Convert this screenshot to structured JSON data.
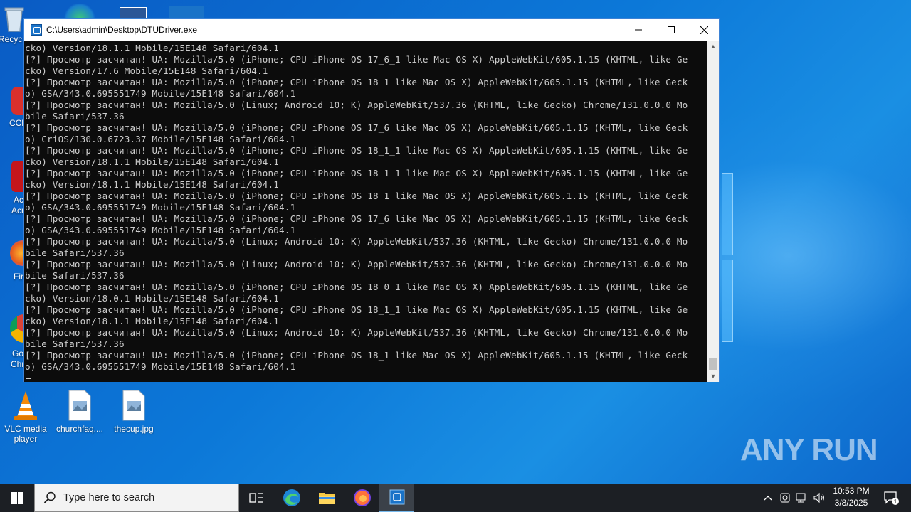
{
  "desktop": {
    "icons": [
      {
        "label": "Recycle Bin",
        "visible_label": "Recyc"
      },
      {
        "label": "VLC media player"
      },
      {
        "label": "churchfaq...."
      },
      {
        "label": "thecup.jpg"
      }
    ],
    "edge_labels": [
      "CCl",
      "Ac",
      "Acr",
      "Fir",
      "Go",
      "Chr"
    ],
    "watermark": "ANY RUN"
  },
  "console": {
    "title": "C:\\Users\\admin\\Desktop\\DTUDriver.exe",
    "minimize_icon": "minimize-icon",
    "maximize_icon": "maximize-icon",
    "close_icon": "close-icon",
    "lines": [
      "cko) Version/18.1.1 Mobile/15E148 Safari/604.1",
      "[?] Просмотр засчитан! UA: Mozilla/5.0 (iPhone; CPU iPhone OS 17_6_1 like Mac OS X) AppleWebKit/605.1.15 (KHTML, like Ge",
      "cko) Version/17.6 Mobile/15E148 Safari/604.1",
      "[?] Просмотр засчитан! UA: Mozilla/5.0 (iPhone; CPU iPhone OS 18_1 like Mac OS X) AppleWebKit/605.1.15 (KHTML, like Geck",
      "o) GSA/343.0.695551749 Mobile/15E148 Safari/604.1",
      "[?] Просмотр засчитан! UA: Mozilla/5.0 (Linux; Android 10; K) AppleWebKit/537.36 (KHTML, like Gecko) Chrome/131.0.0.0 Mo",
      "bile Safari/537.36",
      "[?] Просмотр засчитан! UA: Mozilla/5.0 (iPhone; CPU iPhone OS 17_6 like Mac OS X) AppleWebKit/605.1.15 (KHTML, like Geck",
      "o) CriOS/130.0.6723.37 Mobile/15E148 Safari/604.1",
      "[?] Просмотр засчитан! UA: Mozilla/5.0 (iPhone; CPU iPhone OS 18_1_1 like Mac OS X) AppleWebKit/605.1.15 (KHTML, like Ge",
      "cko) Version/18.1.1 Mobile/15E148 Safari/604.1",
      "[?] Просмотр засчитан! UA: Mozilla/5.0 (iPhone; CPU iPhone OS 18_1_1 like Mac OS X) AppleWebKit/605.1.15 (KHTML, like Ge",
      "cko) Version/18.1.1 Mobile/15E148 Safari/604.1",
      "[?] Просмотр засчитан! UA: Mozilla/5.0 (iPhone; CPU iPhone OS 18_1 like Mac OS X) AppleWebKit/605.1.15 (KHTML, like Geck",
      "o) GSA/343.0.695551749 Mobile/15E148 Safari/604.1",
      "[?] Просмотр засчитан! UA: Mozilla/5.0 (iPhone; CPU iPhone OS 17_6 like Mac OS X) AppleWebKit/605.1.15 (KHTML, like Geck",
      "o) GSA/343.0.695551749 Mobile/15E148 Safari/604.1",
      "[?] Просмотр засчитан! UA: Mozilla/5.0 (Linux; Android 10; K) AppleWebKit/537.36 (KHTML, like Gecko) Chrome/131.0.0.0 Mo",
      "bile Safari/537.36",
      "[?] Просмотр засчитан! UA: Mozilla/5.0 (Linux; Android 10; K) AppleWebKit/537.36 (KHTML, like Gecko) Chrome/131.0.0.0 Mo",
      "bile Safari/537.36",
      "[?] Просмотр засчитан! UA: Mozilla/5.0 (iPhone; CPU iPhone OS 18_0_1 like Mac OS X) AppleWebKit/605.1.15 (KHTML, like Ge",
      "cko) Version/18.0.1 Mobile/15E148 Safari/604.1",
      "[?] Просмотр засчитан! UA: Mozilla/5.0 (iPhone; CPU iPhone OS 18_1_1 like Mac OS X) AppleWebKit/605.1.15 (KHTML, like Ge",
      "cko) Version/18.1.1 Mobile/15E148 Safari/604.1",
      "[?] Просмотр засчитан! UA: Mozilla/5.0 (Linux; Android 10; K) AppleWebKit/537.36 (KHTML, like Gecko) Chrome/131.0.0.0 Mo",
      "bile Safari/537.36",
      "[?] Просмотр засчитан! UA: Mozilla/5.0 (iPhone; CPU iPhone OS 18_1 like Mac OS X) AppleWebKit/605.1.15 (KHTML, like Geck",
      "o) GSA/343.0.695551749 Mobile/15E148 Safari/604.1"
    ]
  },
  "taskbar": {
    "search_placeholder": "Type here to search",
    "time": "10:53 PM",
    "date": "3/8/2025",
    "notification_count": "1"
  },
  "colors": {
    "accent": "#0078d7",
    "console_bg": "#0c0c0c",
    "console_text": "#cccccc",
    "taskbar_bg": "#1c1f24"
  }
}
